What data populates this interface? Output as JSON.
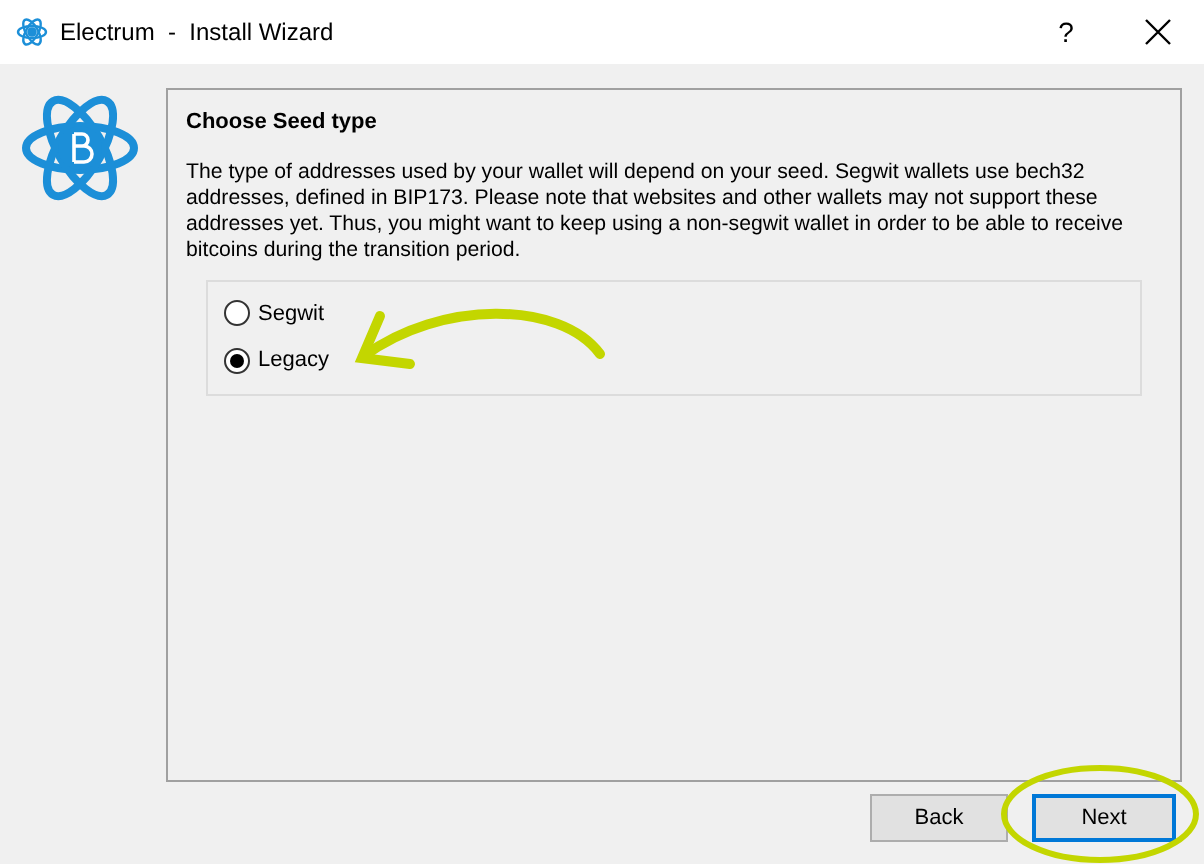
{
  "window": {
    "title": "Electrum  -  Install Wizard",
    "help": "?"
  },
  "page": {
    "heading": "Choose Seed type",
    "description": "The type of addresses used by your wallet will depend on your seed. Segwit wallets use bech32 addresses, defined in BIP173. Please note that websites and other wallets may not support these addresses yet. Thus, you might want to keep using a non-segwit wallet in order to be able to receive bitcoins during the transition period."
  },
  "options": [
    {
      "label": "Segwit",
      "selected": false
    },
    {
      "label": "Legacy",
      "selected": true
    }
  ],
  "buttons": [
    {
      "label": "Back",
      "kind": "plain"
    },
    {
      "label": "Next",
      "kind": "default"
    }
  ]
}
